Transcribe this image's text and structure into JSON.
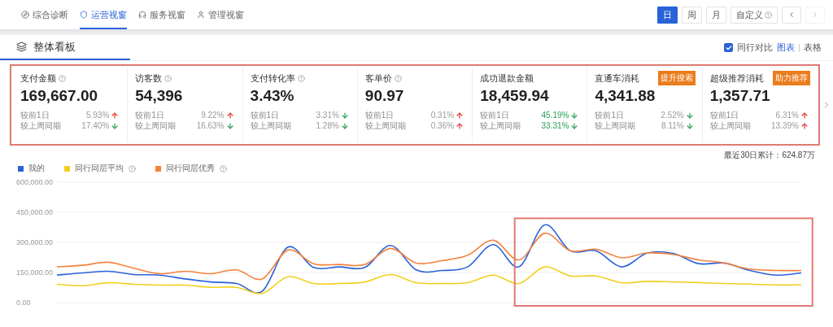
{
  "nav": {
    "tabs": [
      {
        "label": "综合诊断",
        "selected": false
      },
      {
        "label": "运营视窗",
        "selected": true
      },
      {
        "label": "服务视窗",
        "selected": false
      },
      {
        "label": "管理视窗",
        "selected": false
      }
    ],
    "periods": [
      {
        "label": "日",
        "selected": true,
        "help": false
      },
      {
        "label": "周",
        "selected": false,
        "help": false
      },
      {
        "label": "月",
        "selected": false,
        "help": false
      },
      {
        "label": "自定义",
        "selected": false,
        "help": true
      }
    ],
    "prev_disabled": false,
    "next_disabled": true
  },
  "panel": {
    "title": "整体看板",
    "compare": {
      "label": "同行对比",
      "checked": true
    },
    "views": [
      {
        "label": "图表",
        "selected": true
      },
      {
        "label": "表格",
        "selected": false
      }
    ],
    "metrics_highlighted": true,
    "metrics": [
      {
        "name": "支付金额",
        "help": true,
        "value": "169,667.00",
        "deltas": [
          {
            "label": "较前1日",
            "value": "5.93%",
            "kind": "up",
            "colored": false
          },
          {
            "label": "较上周同期",
            "value": "17.40%",
            "kind": "down",
            "colored": false
          }
        ]
      },
      {
        "name": "访客数",
        "help": true,
        "value": "54,396",
        "deltas": [
          {
            "label": "较前1日",
            "value": "9.22%",
            "kind": "up",
            "colored": false
          },
          {
            "label": "较上周同期",
            "value": "16.63%",
            "kind": "down",
            "colored": false
          }
        ]
      },
      {
        "name": "支付转化率",
        "help": true,
        "value": "3.43%",
        "deltas": [
          {
            "label": "较前1日",
            "value": "3.31%",
            "kind": "down",
            "colored": false
          },
          {
            "label": "较上周同期",
            "value": "1.28%",
            "kind": "down",
            "colored": false
          }
        ]
      },
      {
        "name": "客单价",
        "help": true,
        "value": "90.97",
        "deltas": [
          {
            "label": "较前1日",
            "value": "0.31%",
            "kind": "up",
            "colored": false
          },
          {
            "label": "较上周同期",
            "value": "0.36%",
            "kind": "up",
            "colored": false
          }
        ]
      },
      {
        "name": "成功退款金额",
        "help": false,
        "value": "18,459.94",
        "deltas": [
          {
            "label": "较前1日",
            "value": "45.19%",
            "kind": "down",
            "colored": true
          },
          {
            "label": "较上周同期",
            "value": "33.31%",
            "kind": "down",
            "colored": true
          }
        ]
      },
      {
        "name": "直通车消耗",
        "help": false,
        "badge": "提升搜索",
        "value": "4,341.88",
        "deltas": [
          {
            "label": "较前1日",
            "value": "2.52%",
            "kind": "down",
            "colored": false
          },
          {
            "label": "较上周同期",
            "value": "8.11%",
            "kind": "down",
            "colored": false
          }
        ]
      },
      {
        "name": "超级推荐消耗",
        "help": false,
        "badge": "助力推荐",
        "value": "1,357.71",
        "deltas": [
          {
            "label": "较前1日",
            "value": "6.31%",
            "kind": "up",
            "colored": false
          },
          {
            "label": "较上周同期",
            "value": "13.39%",
            "kind": "up",
            "colored": false
          }
        ]
      }
    ],
    "total": "最近30日累计：624.87万",
    "chart_highlighted": true,
    "chart_data": {
      "type": "line",
      "grid": true,
      "series": [
        {
          "name": "我的",
          "color": "#2a62d9",
          "values": [
            137000,
            148000,
            156000,
            140000,
            137000,
            118000,
            103000,
            95000,
            57000,
            277000,
            175000,
            178000,
            175000,
            285000,
            163000,
            160000,
            178000,
            289000,
            178000,
            387000,
            258000,
            258000,
            178000,
            247000,
            245000,
            194000,
            197000,
            160000,
            137000,
            148000
          ]
        },
        {
          "name": "同行同层平均",
          "color": "#f2cf1f",
          "values": [
            91000,
            84000,
            99000,
            91000,
            87000,
            87000,
            76000,
            76000,
            46000,
            129000,
            95000,
            95000,
            103000,
            140000,
            99000,
            95000,
            99000,
            137000,
            95000,
            178000,
            133000,
            133000,
            99000,
            106000,
            103000,
            100000,
            95000,
            92000,
            88000,
            88000
          ]
        },
        {
          "name": "同行同层优秀",
          "color": "#f5823d",
          "values": [
            178000,
            186000,
            201000,
            171000,
            144000,
            156000,
            144000,
            163000,
            118000,
            262000,
            194000,
            190000,
            190000,
            270000,
            197000,
            209000,
            236000,
            311000,
            213000,
            345000,
            258000,
            266000,
            224000,
            247000,
            240000,
            213000,
            197000,
            167000,
            160000,
            160000
          ]
        }
      ],
      "ylim": [
        0,
        600000
      ],
      "yticks": [
        {
          "value": 0,
          "label": "0.00"
        },
        {
          "value": 150000,
          "label": "150,000.00"
        },
        {
          "value": 300000,
          "label": "300,000.00"
        },
        {
          "value": 450000,
          "label": "450,000.00"
        },
        {
          "value": 600000,
          "label": "600,000.00"
        }
      ]
    }
  }
}
